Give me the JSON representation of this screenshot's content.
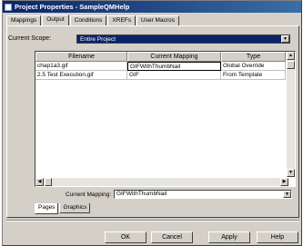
{
  "window": {
    "title": "Project Properties - SampleQMHelp"
  },
  "tabs": [
    {
      "label": "Mappings"
    },
    {
      "label": "Output"
    },
    {
      "label": "Conditions"
    },
    {
      "label": "XREFs"
    },
    {
      "label": "User Macros"
    }
  ],
  "scope": {
    "label": "Current Scope:",
    "value": "Entire Project"
  },
  "grid": {
    "columns": [
      "Filename",
      "Current Mapping",
      "Type"
    ],
    "rows": [
      {
        "filename": "chap1a3.gif",
        "mapping": "GIFWithThumbNail",
        "type": "Global Override"
      },
      {
        "filename": "2.5 Test Execution.gif",
        "mapping": "GIF",
        "type": "From Template"
      }
    ]
  },
  "current_mapping": {
    "label": "Current Mapping:",
    "value": "GIFWithThumbNail"
  },
  "subtabs": [
    {
      "label": "Pages"
    },
    {
      "label": "Graphics"
    }
  ],
  "buttons": {
    "ok": "OK",
    "cancel": "Cancel",
    "apply": "Apply",
    "help": "Help"
  },
  "colors": {
    "titlebar_start": "#0a246a",
    "titlebar_end": "#3a6ea5",
    "face": "#d4d0c8",
    "selection": "#0a246a"
  }
}
